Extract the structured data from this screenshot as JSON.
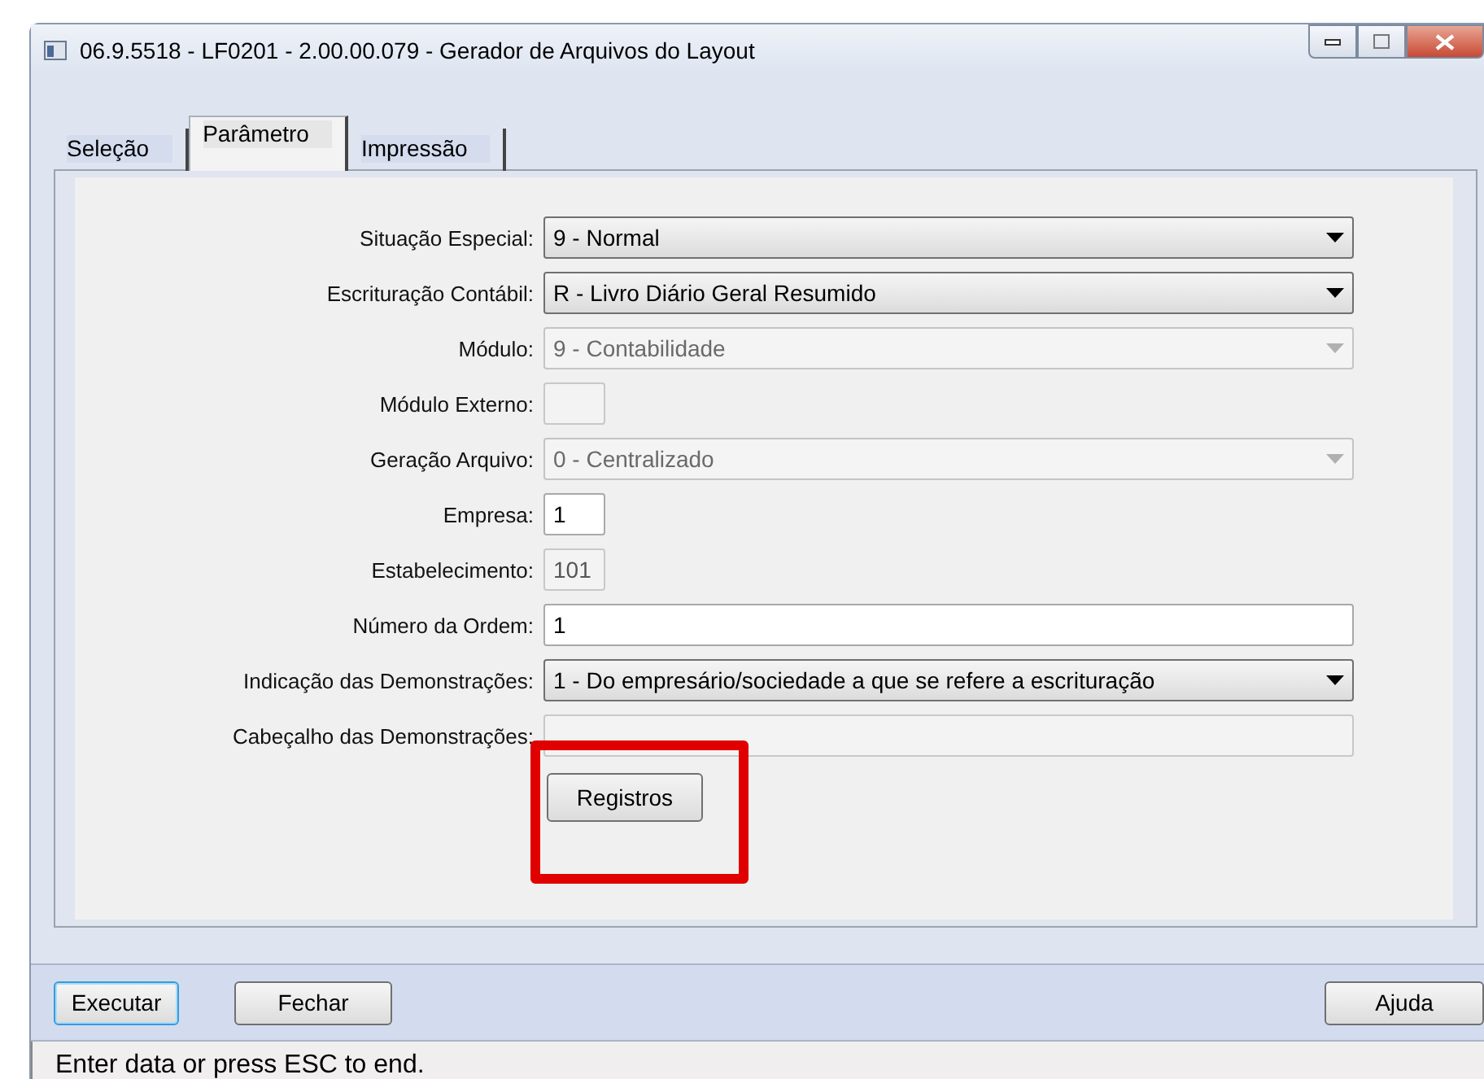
{
  "window": {
    "title": "06.9.5518 - LF0201 - 2.00.00.079 - Gerador de Arquivos do Layout"
  },
  "tabs": [
    {
      "label": "Seleção",
      "selected": false
    },
    {
      "label": "Parâmetro",
      "selected": true
    },
    {
      "label": "Impressão",
      "selected": false
    }
  ],
  "fields": [
    {
      "label": "Situação Especial:",
      "kind": "select",
      "value": "9 - Normal",
      "disabled": false
    },
    {
      "label": "Escrituração Contábil:",
      "kind": "select",
      "value": "R - Livro Diário Geral Resumido",
      "disabled": false
    },
    {
      "label": "Módulo:",
      "kind": "select",
      "value": "9 - Contabilidade",
      "disabled": true
    },
    {
      "label": "Módulo Externo:",
      "kind": "short",
      "disabled": true
    },
    {
      "label": "Geração Arquivo:",
      "kind": "select",
      "value": "0 - Centralizado",
      "disabled": true
    },
    {
      "label": "Empresa:",
      "kind": "short",
      "value": "1",
      "disabled": false
    },
    {
      "label": "Estabelecimento:",
      "kind": "short",
      "value": "101",
      "disabled": true
    },
    {
      "label": "Número da Ordem:",
      "kind": "text",
      "value": "1",
      "disabled": false
    },
    {
      "label": "Indicação das Demonstrações:",
      "kind": "select",
      "value": "1 - Do empresário/sociedade a que se refere a escrituração",
      "disabled": false
    },
    {
      "label": "Cabeçalho das Demonstrações:",
      "kind": "text",
      "disabled": true
    }
  ],
  "panel_button": {
    "label": "Registros",
    "highlighted": true
  },
  "footer_buttons": [
    {
      "label": "Executar",
      "kind": "default"
    },
    {
      "label": "Fechar",
      "kind": "normal"
    },
    {
      "label": "Ajuda",
      "kind": "help"
    }
  ],
  "status_bar": "Enter data or press ESC to end."
}
